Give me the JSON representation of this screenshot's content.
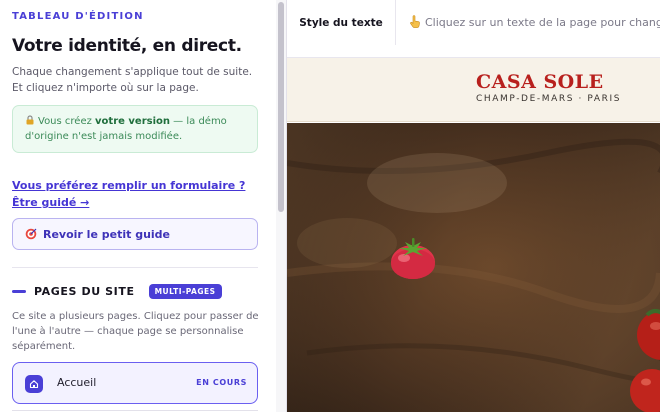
{
  "panel": {
    "eyebrow": "TABLEAU D'ÉDITION",
    "title": "Votre identité, en direct.",
    "intro": "Chaque changement s'applique tout de suite. Et cliquez n'importe où sur la page.",
    "notice": {
      "icon": "lock-icon",
      "prefix": "Vous créez ",
      "emphasis": "votre version",
      "suffix": " — la démo d'origine n'est jamais modifiée."
    },
    "form_link": "Vous préférez remplir un formulaire ? Être guidé →",
    "guide_button": {
      "icon": "target-icon",
      "label": "Revoir le petit guide"
    },
    "pages": {
      "heading": "PAGES DU SITE",
      "badge": "MULTI-PAGES",
      "description": "Ce site a plusieurs pages. Cliquez pour passer de l'une à l'autre — chaque page se personnalise séparément.",
      "items": [
        {
          "icon": "home-icon",
          "name": "Accueil",
          "status": "EN COURS"
        }
      ]
    }
  },
  "toolbar": {
    "tab_label": "Style du texte",
    "hint_icon": "pointing-hand-icon",
    "hint": "Cliquez sur un texte de la page pour changer"
  },
  "site": {
    "brand": "CASA SOLE",
    "tagline": "CHAMP-DE-MARS · PARIS"
  },
  "colors": {
    "accent": "#4a3fd6",
    "brand_red": "#b8201d",
    "notice_green": "#3b8a58"
  }
}
